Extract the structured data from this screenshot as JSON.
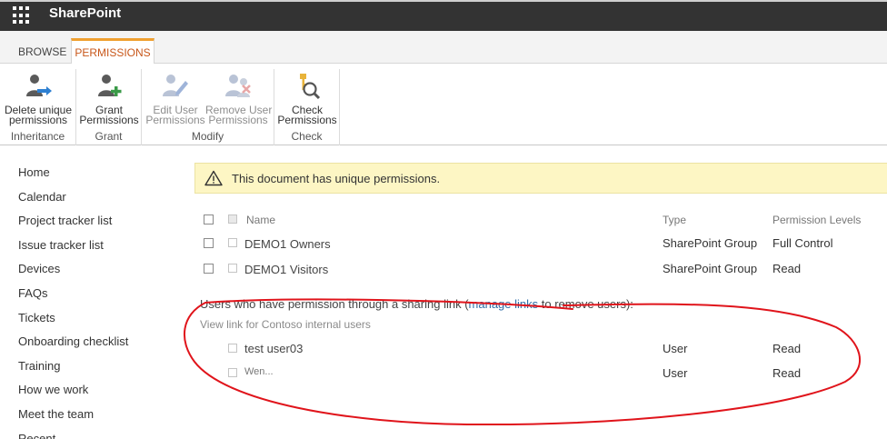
{
  "app": {
    "title": "SharePoint"
  },
  "ribbon": {
    "tabs": {
      "browse": "BROWSE",
      "permissions": "PERMISSIONS"
    },
    "groups": {
      "inheritance": "Inheritance",
      "grant": "Grant",
      "modify": "Modify",
      "check": "Check"
    },
    "buttons": {
      "delete_unique": [
        "Delete unique",
        "permissions"
      ],
      "grant": [
        "Grant",
        "Permissions"
      ],
      "edit_user": [
        "Edit User",
        "Permissions"
      ],
      "remove_user": [
        "Remove User",
        "Permissions"
      ],
      "check": [
        "Check",
        "Permissions"
      ]
    }
  },
  "nav": {
    "items": [
      "Home",
      "Calendar",
      "Project tracker list",
      "Issue tracker list",
      "Devices",
      "FAQs",
      "Tickets",
      "Onboarding checklist",
      "Training",
      "How we work",
      "Meet the team",
      "Recent"
    ]
  },
  "banner": {
    "text": "This document has unique permissions."
  },
  "table": {
    "headers": {
      "name": "Name",
      "type": "Type",
      "level": "Permission Levels"
    },
    "rows": [
      {
        "name": "DEMO1 Owners",
        "type": "SharePoint Group",
        "level": "Full Control"
      },
      {
        "name": "DEMO1 Visitors",
        "type": "SharePoint Group",
        "level": "Read"
      }
    ]
  },
  "sharing": {
    "prefix": "Users who have permission through a sharing link (",
    "link": "manage links",
    "suffix": " to remove users):",
    "view_link": "View link for Contoso internal users",
    "rows": [
      {
        "name": "test user03",
        "type": "User",
        "level": "Read"
      },
      {
        "name": "Wen...",
        "type": "User",
        "level": "Read"
      }
    ]
  },
  "colors": {
    "suitebar": "#333333",
    "accent_tab": "#f0a030",
    "banner": "#fdf6c4",
    "annotation": "#e0141b",
    "link": "#2f6ea8"
  }
}
